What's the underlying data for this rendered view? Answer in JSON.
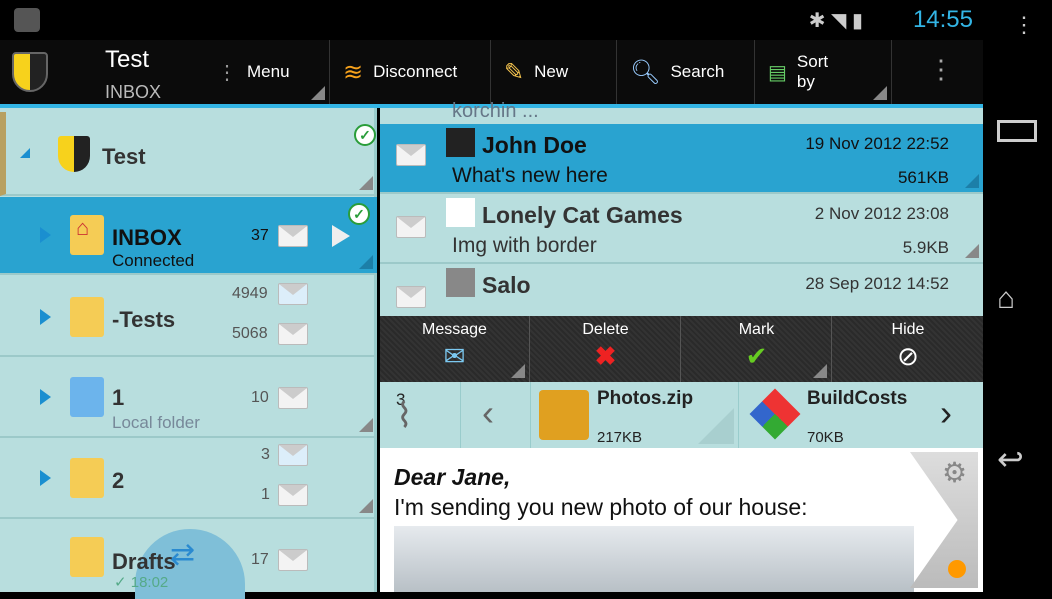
{
  "status": {
    "time": "14:55"
  },
  "actionbar": {
    "account": "Test",
    "folder": "INBOX",
    "menu": "Menu",
    "disconnect": "Disconnect",
    "new": "New",
    "search": "Search",
    "sort": "Sort by"
  },
  "folders": [
    {
      "name": "Test"
    },
    {
      "name": "INBOX",
      "sub": "Connected",
      "count": "37"
    },
    {
      "name": "-Tests",
      "count_new": "4949",
      "count": "5068"
    },
    {
      "name": "1",
      "sub": "Local folder",
      "count": "10"
    },
    {
      "name": "2",
      "count_new": "3",
      "count": "1"
    },
    {
      "name": "Drafts",
      "sub": "✓ 18:02",
      "count": "17"
    }
  ],
  "messages": {
    "prev_snippet": "korchin ...",
    "items": [
      {
        "from": "John Doe",
        "date": "19 Nov 2012 22:52",
        "subject": "What's new here",
        "size": "561KB"
      },
      {
        "from": "Lonely Cat Games",
        "date": "2 Nov 2012 23:08",
        "subject": "Img with border",
        "size": "5.9KB"
      },
      {
        "from": "Salo",
        "date": "28 Sep 2012 14:52",
        "subject": "",
        "size": ""
      }
    ]
  },
  "toolbar": {
    "message": "Message",
    "delete": "Delete",
    "mark": "Mark",
    "hide": "Hide"
  },
  "attachments": {
    "count": "3",
    "items": [
      {
        "name": "Photos.zip",
        "size": "217KB"
      },
      {
        "name": "BuildCosts",
        "size": "70KB"
      }
    ]
  },
  "body": {
    "greeting": "Dear Jane,",
    "line1": "I'm sending you new photo of our house:"
  },
  "colors": {
    "accent": "#33b5e5",
    "selected": "#29a3d0",
    "pane": "#b8dede"
  }
}
